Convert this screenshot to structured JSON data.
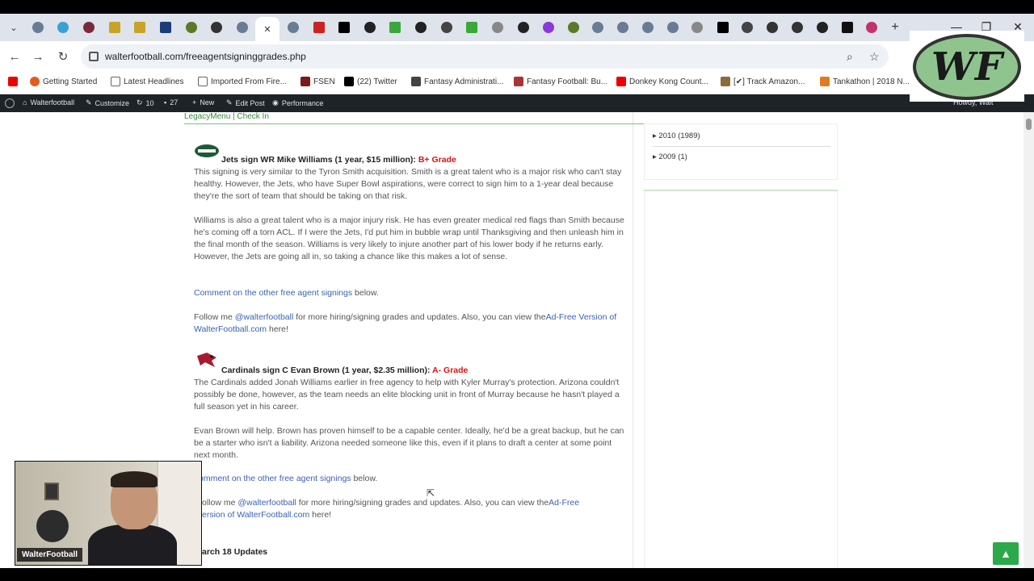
{
  "browser": {
    "url": "walterfootball.com/freeagentsigninggrades.php",
    "new_tab": "+",
    "close_tab": "✕",
    "window_controls": {
      "minimize": "—",
      "maximize": "❐",
      "close": "✕"
    }
  },
  "bookmarks": [
    {
      "label": "Getting Started",
      "color": "#e25c1e"
    },
    {
      "label": "Latest Headlines",
      "color": "#999"
    },
    {
      "label": "Imported From Fire...",
      "color": "#999"
    },
    {
      "label": "FSEN",
      "color": "#7a1a1a"
    },
    {
      "label": "(22) Twitter",
      "color": "#000"
    },
    {
      "label": "Fantasy Administrati...",
      "color": "#444"
    },
    {
      "label": "Fantasy Football: Bu...",
      "color": "#a33"
    },
    {
      "label": "Donkey Kong Count...",
      "color": "#e00"
    },
    {
      "label": "[✔] Track Amazon...",
      "color": "#8b6b3b"
    },
    {
      "label": "Tankathon | 2018 N...",
      "color": "#e07b1f"
    }
  ],
  "wp_admin": {
    "site": "Walterfootball",
    "customize": "Customize",
    "updates": "10",
    "comments": "27",
    "new": "New",
    "edit_post": "Edit Post",
    "performance": "Performance",
    "howdy": "Howdy, Walt"
  },
  "page": {
    "legacy_links": "LegacyMenu | Check In",
    "articles": [
      {
        "team": "Jets",
        "headline": "Jets sign WR Mike Williams (1 year, $15 million): ",
        "grade": "B+ Grade",
        "p1": "This signing is very similar to the Tyron Smith acquisition. Smith is a great talent who is a major risk who can't stay healthy. However, the Jets, who have Super Bowl aspirations, were correct to sign him to a 1-year deal because they're the sort of team that should be taking on that risk.",
        "p2": "Williams is also a great talent who is a major injury risk. He has even greater medical red flags than Smith because he's coming off a torn ACL. If I were the Jets, I'd put him in bubble wrap until Thanksgiving and then unleash him in the final month of the season. Williams is very likely to injure another part of his lower body if he returns early. However, the Jets are going all in, so taking a chance like this makes a lot of sense.",
        "comment_link": "Comment on the other free agent signings",
        "comment_tail": " below.",
        "follow_pre": "Follow me ",
        "follow_handle": "@walterfootball",
        "follow_mid": " for more hiring/signing grades and updates. Also, you can view the",
        "follow_link": "Ad-Free Version of WalterFootball.com",
        "follow_tail": " here!"
      },
      {
        "team": "Cardinals",
        "headline": "Cardinals sign C Evan Brown (1 year, $2.35 million): ",
        "grade": "A- Grade",
        "p1": "The Cardinals added Jonah Williams earlier in free agency to help with Kyler Murray's protection. Arizona couldn't possibly be done, however, as the team needs an elite blocking unit in front of Murray because he hasn't played a full season yet in his career.",
        "p2": "Evan Brown will help. Brown has proven himself to be a capable center. Ideally, he'd be a great backup, but he can be a starter who isn't a liability. Arizona needed someone like this, even if it plans to draft a center at some point next month.",
        "comment_link": "omment on the other free agent signings",
        "comment_tail": " below.",
        "follow_pre": "ollow me ",
        "follow_handle": "@walterfootball",
        "follow_mid": " for more hiring/signing grades and updates. Also, you can view the",
        "follow_link_1": "Ad-Free",
        "follow_link_2": "ersion of WalterFootball.com",
        "follow_tail": " here!"
      }
    ],
    "section_heading": "arch 18 Updates"
  },
  "sidebar": {
    "archives": [
      "2010 (1989)",
      "2009 (1)"
    ]
  },
  "webcam": {
    "label": "WalterFootball"
  },
  "overlay_logo": {
    "text": "WF"
  },
  "back_to_top": "▲"
}
